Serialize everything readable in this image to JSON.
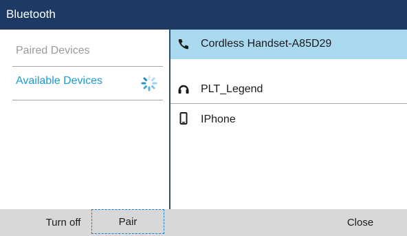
{
  "window": {
    "title": "Bluetooth"
  },
  "sidebar": {
    "items": [
      {
        "label": "Paired Devices",
        "state": "inactive"
      },
      {
        "label": "Available Devices",
        "state": "active",
        "loading": true
      }
    ]
  },
  "devices": [
    {
      "icon": "cordless-phone-icon",
      "label": "Cordless Handset-A85D29",
      "selected": true
    },
    {
      "icon": "headset-icon",
      "label": "PLT_Legend",
      "selected": false
    },
    {
      "icon": "mobile-phone-icon",
      "label": "IPhone",
      "selected": false
    }
  ],
  "softkeys": {
    "turn_off": "Turn off",
    "pair": "Pair",
    "close": "Close"
  },
  "colors": {
    "titlebar": "#1c3a63",
    "accent": "#1a9ad6",
    "selected_row": "#a9d9ef",
    "softkey_bar": "#d8d8d8"
  }
}
